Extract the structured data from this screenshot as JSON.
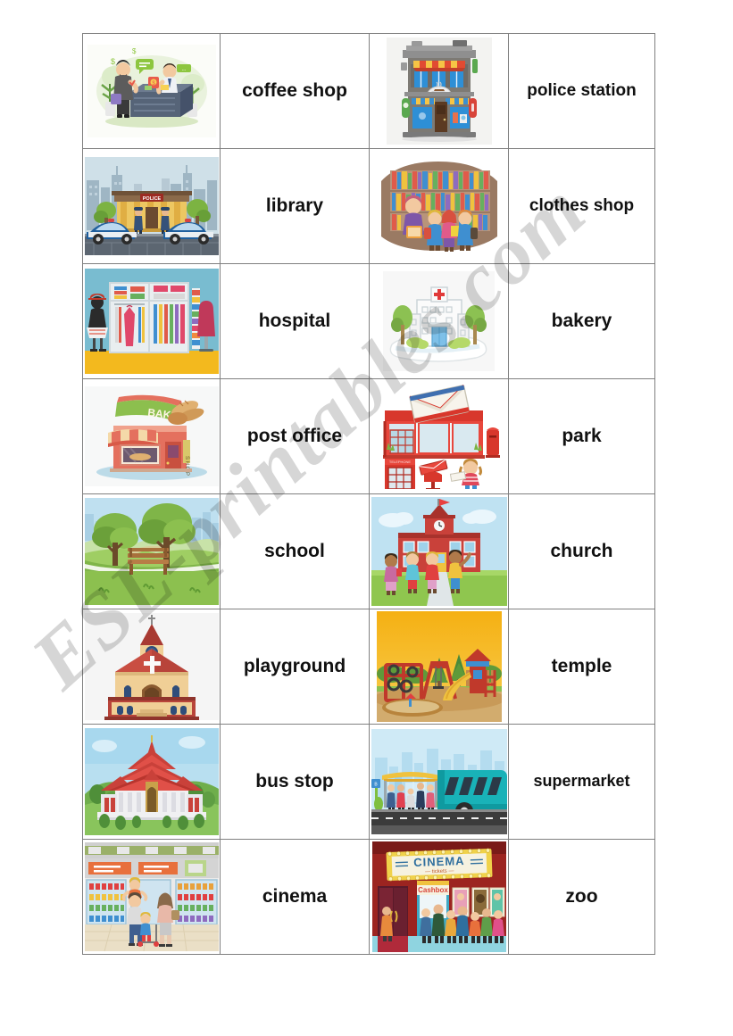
{
  "document": {
    "type": "esl-vocabulary-matching-worksheet",
    "topic": "places in town",
    "watermark": "ESL-printables.com"
  },
  "table": {
    "columns": [
      "picture",
      "word",
      "picture",
      "word"
    ],
    "rows": [
      {
        "left_picture": "coffee-shop-bank-counter-scene",
        "left_word": "coffee  shop",
        "right_picture": "coffee-shop-building",
        "right_word": "police station"
      },
      {
        "left_picture": "police-station-building-with-cars",
        "left_word": "library",
        "right_picture": "library-children-bookshelves",
        "right_word": "clothes shop"
      },
      {
        "left_picture": "clothes-shop-window-mannequins",
        "left_word": "hospital",
        "right_picture": "hospital-building-with-trees",
        "right_word": "bakery"
      },
      {
        "left_picture": "bakery-shop-front",
        "left_word": "post  office",
        "right_picture": "post-office-with-envelope-and-phone-box",
        "right_word": "park"
      },
      {
        "left_picture": "park-with-trees-and-bench",
        "left_word": "school",
        "right_picture": "school-building-with-children",
        "right_word": "church"
      },
      {
        "left_picture": "church-building",
        "left_word": "playground",
        "right_picture": "playground-with-slide-and-swings",
        "right_word": "temple"
      },
      {
        "left_picture": "temple-building",
        "left_word": "bus stop",
        "right_picture": "bus-stop-with-bus-and-people",
        "right_word": "supermarket"
      },
      {
        "left_picture": "supermarket-interior-with-family",
        "left_word": "cinema",
        "right_picture": "cinema-building-with-queue",
        "right_word": "zoo"
      }
    ]
  },
  "picture_labels": {
    "bakery_sign": "BAKERY",
    "bakery_side_sign": "SHOP",
    "police_sign": "POLICE",
    "cinema_sign": "CINEMA",
    "cinema_tickets": "tickets",
    "cinema_cashbox": "Cashbox",
    "phone_box": "TELEPHONE"
  },
  "colors": {
    "border": "#808080",
    "text": "#111111",
    "watermark": "rgba(0,0,0,0.16)",
    "page_background": "#ffffff"
  }
}
